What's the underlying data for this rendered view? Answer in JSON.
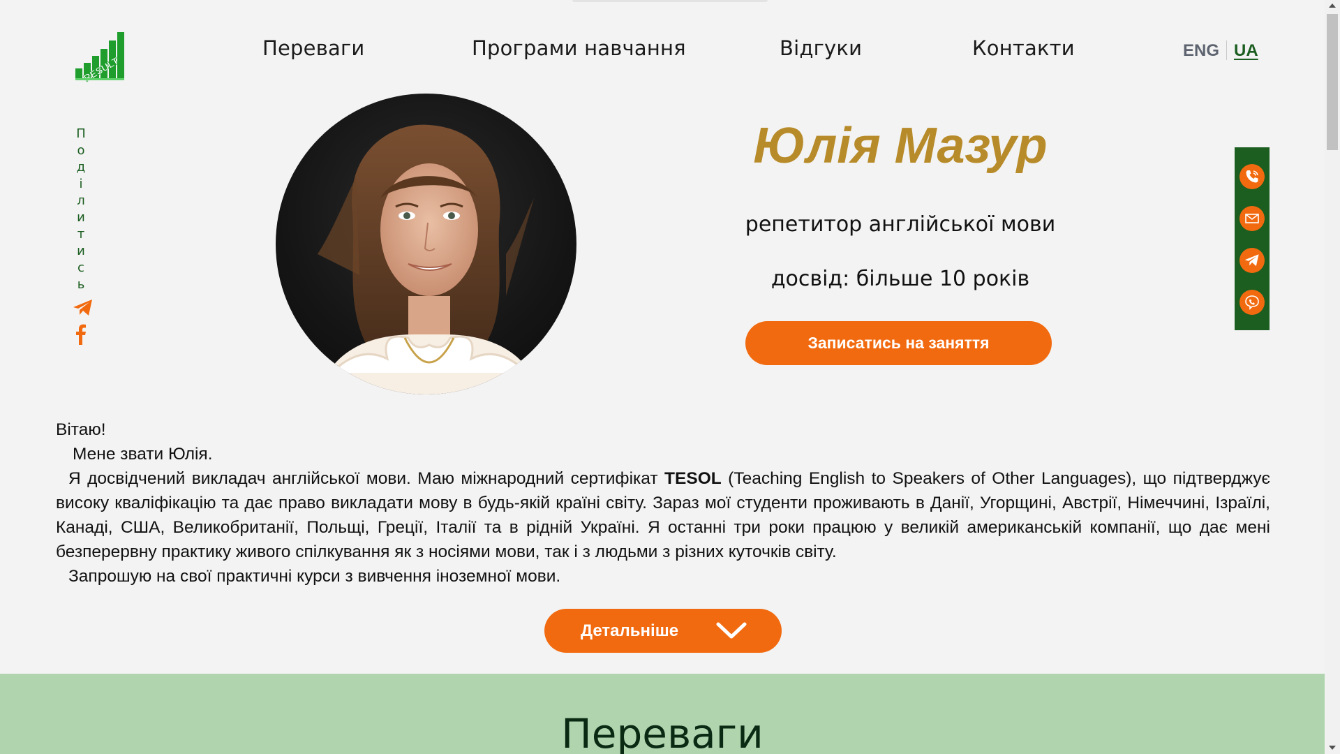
{
  "nav": {
    "items": [
      "Переваги",
      "Програми навчання",
      "Відгуки",
      "Контакти"
    ]
  },
  "logo": {
    "text": "RESULT"
  },
  "lang": {
    "eng": "ENG",
    "ua": "UA",
    "active": "UA"
  },
  "share": {
    "label_letters": [
      "П",
      "о",
      "д",
      "і",
      "л",
      "и",
      "т",
      "и",
      "с",
      "ь"
    ],
    "icons": [
      "telegram-icon",
      "facebook-icon"
    ]
  },
  "hero": {
    "name": "Юлія Мазур",
    "subtitle": "репетитор англійської мови",
    "experience": "досвід: більше 10 років",
    "cta": "Записатись на заняття"
  },
  "contacts": {
    "icons": [
      "phone-icon",
      "mail-icon",
      "telegram-icon",
      "viber-icon"
    ]
  },
  "intro": {
    "greeting": "Вітаю!",
    "name_line": "Мене звати Юлія.",
    "p1_before": "Я досвідчений викладач англійської мови. Маю міжнародний сертифікат ",
    "p1_bold": "TESOL",
    "p1_after": " (Teaching English to Speakers of Other Languages), що підтверджує високу кваліфікацію та дає право викладати мову в будь-якій країні світу. Зараз мої студенти проживають в Данії, Угорщині, Австрії, Німеччині, Ізраїлі, Канаді, США, Великобританії, Польщі, Греції, Італії та в рідній Україні. Я останні три роки працюю у великій американській компанії, що дає мені безперервну практику живого спілкування як з носіями мови, так і з людьми з різних куточків світу.",
    "p2": "Запрошую на свої практичні курси з вивчення іноземної мови."
  },
  "more_button": {
    "label": "Детальніше"
  },
  "advantages": {
    "title": "Переваги"
  },
  "colors": {
    "accent": "#f26a0f",
    "green": "#1b5e20",
    "name_gold": "#b88b2a",
    "band": "#b0d5ae",
    "background": "#f3f3f3"
  }
}
